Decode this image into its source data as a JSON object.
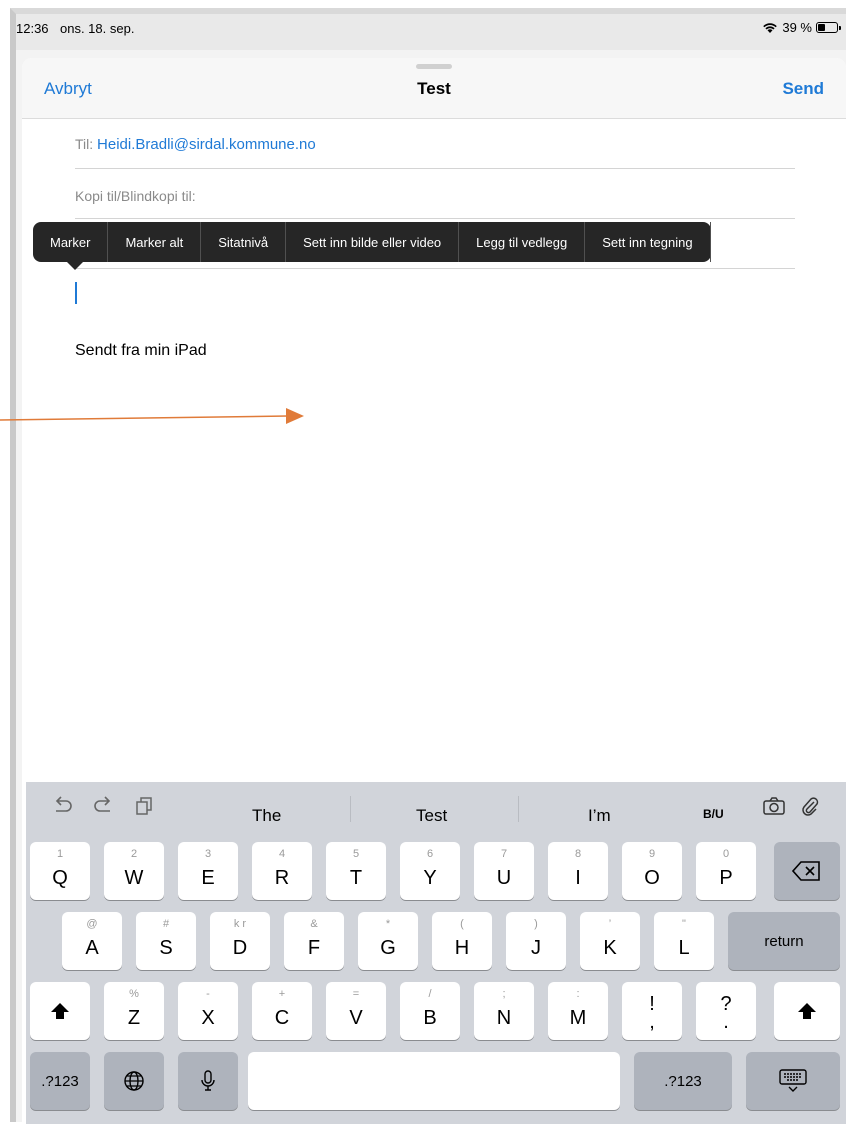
{
  "status": {
    "time": "12:36",
    "date": "ons. 18. sep.",
    "battery": "39 %",
    "battery_level": 0.39
  },
  "nav": {
    "cancel": "Avbryt",
    "title": "Test",
    "send": "Send"
  },
  "to": {
    "label": "Til:",
    "address": "Heidi.Bradli@sirdal.kommune.no"
  },
  "cc": {
    "label": "Kopi til/Blindkopi til:"
  },
  "edit_menu": [
    "Marker",
    "Marker alt",
    "Sitatnivå",
    "Sett inn bilde eller video",
    "Legg til vedlegg",
    "Sett inn tegning"
  ],
  "body": {
    "signature": "Sendt fra min iPad"
  },
  "suggestions": {
    "words": [
      "The",
      "Test",
      "I’m"
    ],
    "format": "B/U"
  },
  "keyboard": {
    "row1": [
      {
        "k": "Q",
        "h": "1"
      },
      {
        "k": "W",
        "h": "2"
      },
      {
        "k": "E",
        "h": "3"
      },
      {
        "k": "R",
        "h": "4"
      },
      {
        "k": "T",
        "h": "5"
      },
      {
        "k": "Y",
        "h": "6"
      },
      {
        "k": "U",
        "h": "7"
      },
      {
        "k": "I",
        "h": "8"
      },
      {
        "k": "O",
        "h": "9"
      },
      {
        "k": "P",
        "h": "0"
      }
    ],
    "row2": [
      {
        "k": "A",
        "h": "@"
      },
      {
        "k": "S",
        "h": "#"
      },
      {
        "k": "D",
        "h": "k r"
      },
      {
        "k": "F",
        "h": "&"
      },
      {
        "k": "G",
        "h": "*"
      },
      {
        "k": "H",
        "h": "("
      },
      {
        "k": "J",
        "h": ")"
      },
      {
        "k": "K",
        "h": "’"
      },
      {
        "k": "L",
        "h": "\""
      }
    ],
    "row3": [
      {
        "k": "Z",
        "h": "%"
      },
      {
        "k": "X",
        "h": "-"
      },
      {
        "k": "C",
        "h": "+"
      },
      {
        "k": "V",
        "h": "="
      },
      {
        "k": "B",
        "h": "/"
      },
      {
        "k": "N",
        "h": ";"
      },
      {
        "k": "M",
        "h": ":"
      },
      {
        "k": "!",
        "h": ","
      },
      {
        "k": "?",
        "h": "."
      }
    ],
    "return": "return",
    "numbers_left": ".?123",
    "numbers_right": ".?123"
  },
  "colors": {
    "accent": "#1f7ad6",
    "annotation_arrow": "#e07b39"
  }
}
